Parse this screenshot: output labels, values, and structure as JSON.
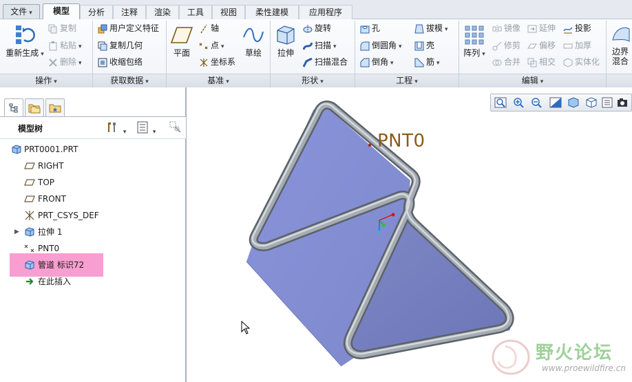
{
  "tabs": [
    {
      "label": "文件",
      "caret": "▾"
    },
    {
      "label": "模型"
    },
    {
      "label": "分析"
    },
    {
      "label": "注释"
    },
    {
      "label": "渲染"
    },
    {
      "label": "工具"
    },
    {
      "label": "视图"
    },
    {
      "label": "柔性建模"
    },
    {
      "label": "应用程序"
    }
  ],
  "ribbon": {
    "operations": {
      "footer": "操作",
      "regenerate": "重新生成",
      "copy": "复制",
      "paste": "粘贴",
      "delete": "删除"
    },
    "get_data": {
      "footer": "获取数据",
      "udf": "用户定义特征",
      "copy_geometry": "复制几何",
      "shrinkwrap": "收缩包络"
    },
    "datum": {
      "footer": "基准",
      "plane": "平面",
      "axis": "轴",
      "point": "点",
      "csys": "坐标系",
      "sketch": "草绘"
    },
    "shapes": {
      "footer": "形状",
      "extrude": "拉伸",
      "revolve": "旋转",
      "sweep": "扫描",
      "swept_blend": "扫描混合"
    },
    "engineering": {
      "footer": "工程",
      "hole": "孔",
      "round": "倒圆角",
      "chamfer": "倒角",
      "draft": "拔模",
      "shell": "壳",
      "rib": "筋"
    },
    "editing": {
      "footer": "编辑",
      "pattern": "阵列",
      "mirror": "镜像",
      "extend": "延伸",
      "project": "投影",
      "trim": "修剪",
      "offset": "偏移",
      "thicken": "加厚",
      "merge": "合并",
      "intersect": "相交",
      "solidify": "实体化"
    },
    "surfaces": {
      "boundary_blend_1": "边界",
      "boundary_blend_2": "混合"
    }
  },
  "model_tree": {
    "title": "模型树",
    "items": [
      {
        "label": "PRT0001.PRT",
        "icon": "part-icon"
      },
      {
        "label": "RIGHT",
        "icon": "datum-plane-icon"
      },
      {
        "label": "TOP",
        "icon": "datum-plane-icon"
      },
      {
        "label": "FRONT",
        "icon": "datum-plane-icon"
      },
      {
        "label": "PRT_CSYS_DEF",
        "icon": "csys-icon"
      },
      {
        "label": "拉伸 1",
        "icon": "extrude-feature-icon",
        "expandable": true
      },
      {
        "label": "PNT0",
        "icon": "datum-point-icon"
      },
      {
        "label": "管道 标识72",
        "icon": "pipe-feature-icon",
        "selected": true
      },
      {
        "label": "在此插入",
        "icon": "insert-here-arrow-icon"
      }
    ]
  },
  "graphics": {
    "point_label": "PNT0"
  },
  "watermark": {
    "text": "野火论坛",
    "url": "www.proewildfire.cn"
  },
  "colors": {
    "accent_selection": "#f99ed0",
    "model_surface": "#8a94d6",
    "pipe": "#8f969e",
    "point_label": "#8b5a1c"
  }
}
